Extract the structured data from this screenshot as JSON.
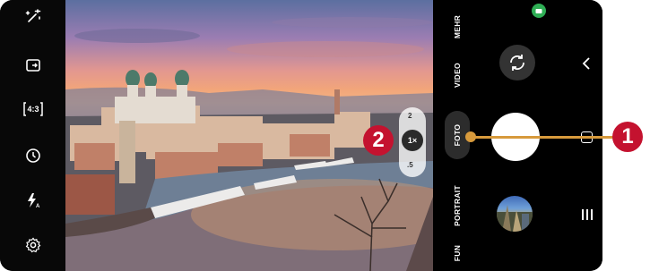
{
  "left_bar": {
    "aspect_ratio_label": "4:3"
  },
  "viewfinder": {
    "zoom": {
      "upper_label": "2",
      "selected_label": "1×",
      "lower_label": ".5"
    }
  },
  "right_panel": {
    "modes": [
      "MEHR",
      "VIDEO",
      "FOTO",
      "PORTRAIT",
      "FUN"
    ],
    "active_mode": "FOTO"
  },
  "annotations": {
    "badge_1": "1",
    "badge_2": "2",
    "badge_color": "#c4122f",
    "leader_color": "#d79a3c"
  },
  "icons": [
    "magic-wand-icon",
    "rotate-screen-icon",
    "aspect-ratio-icon",
    "timer-icon",
    "flash-auto-icon",
    "settings-gear-icon",
    "switch-camera-icon",
    "chevron-left-icon",
    "recents-icon",
    "menu-icon"
  ]
}
